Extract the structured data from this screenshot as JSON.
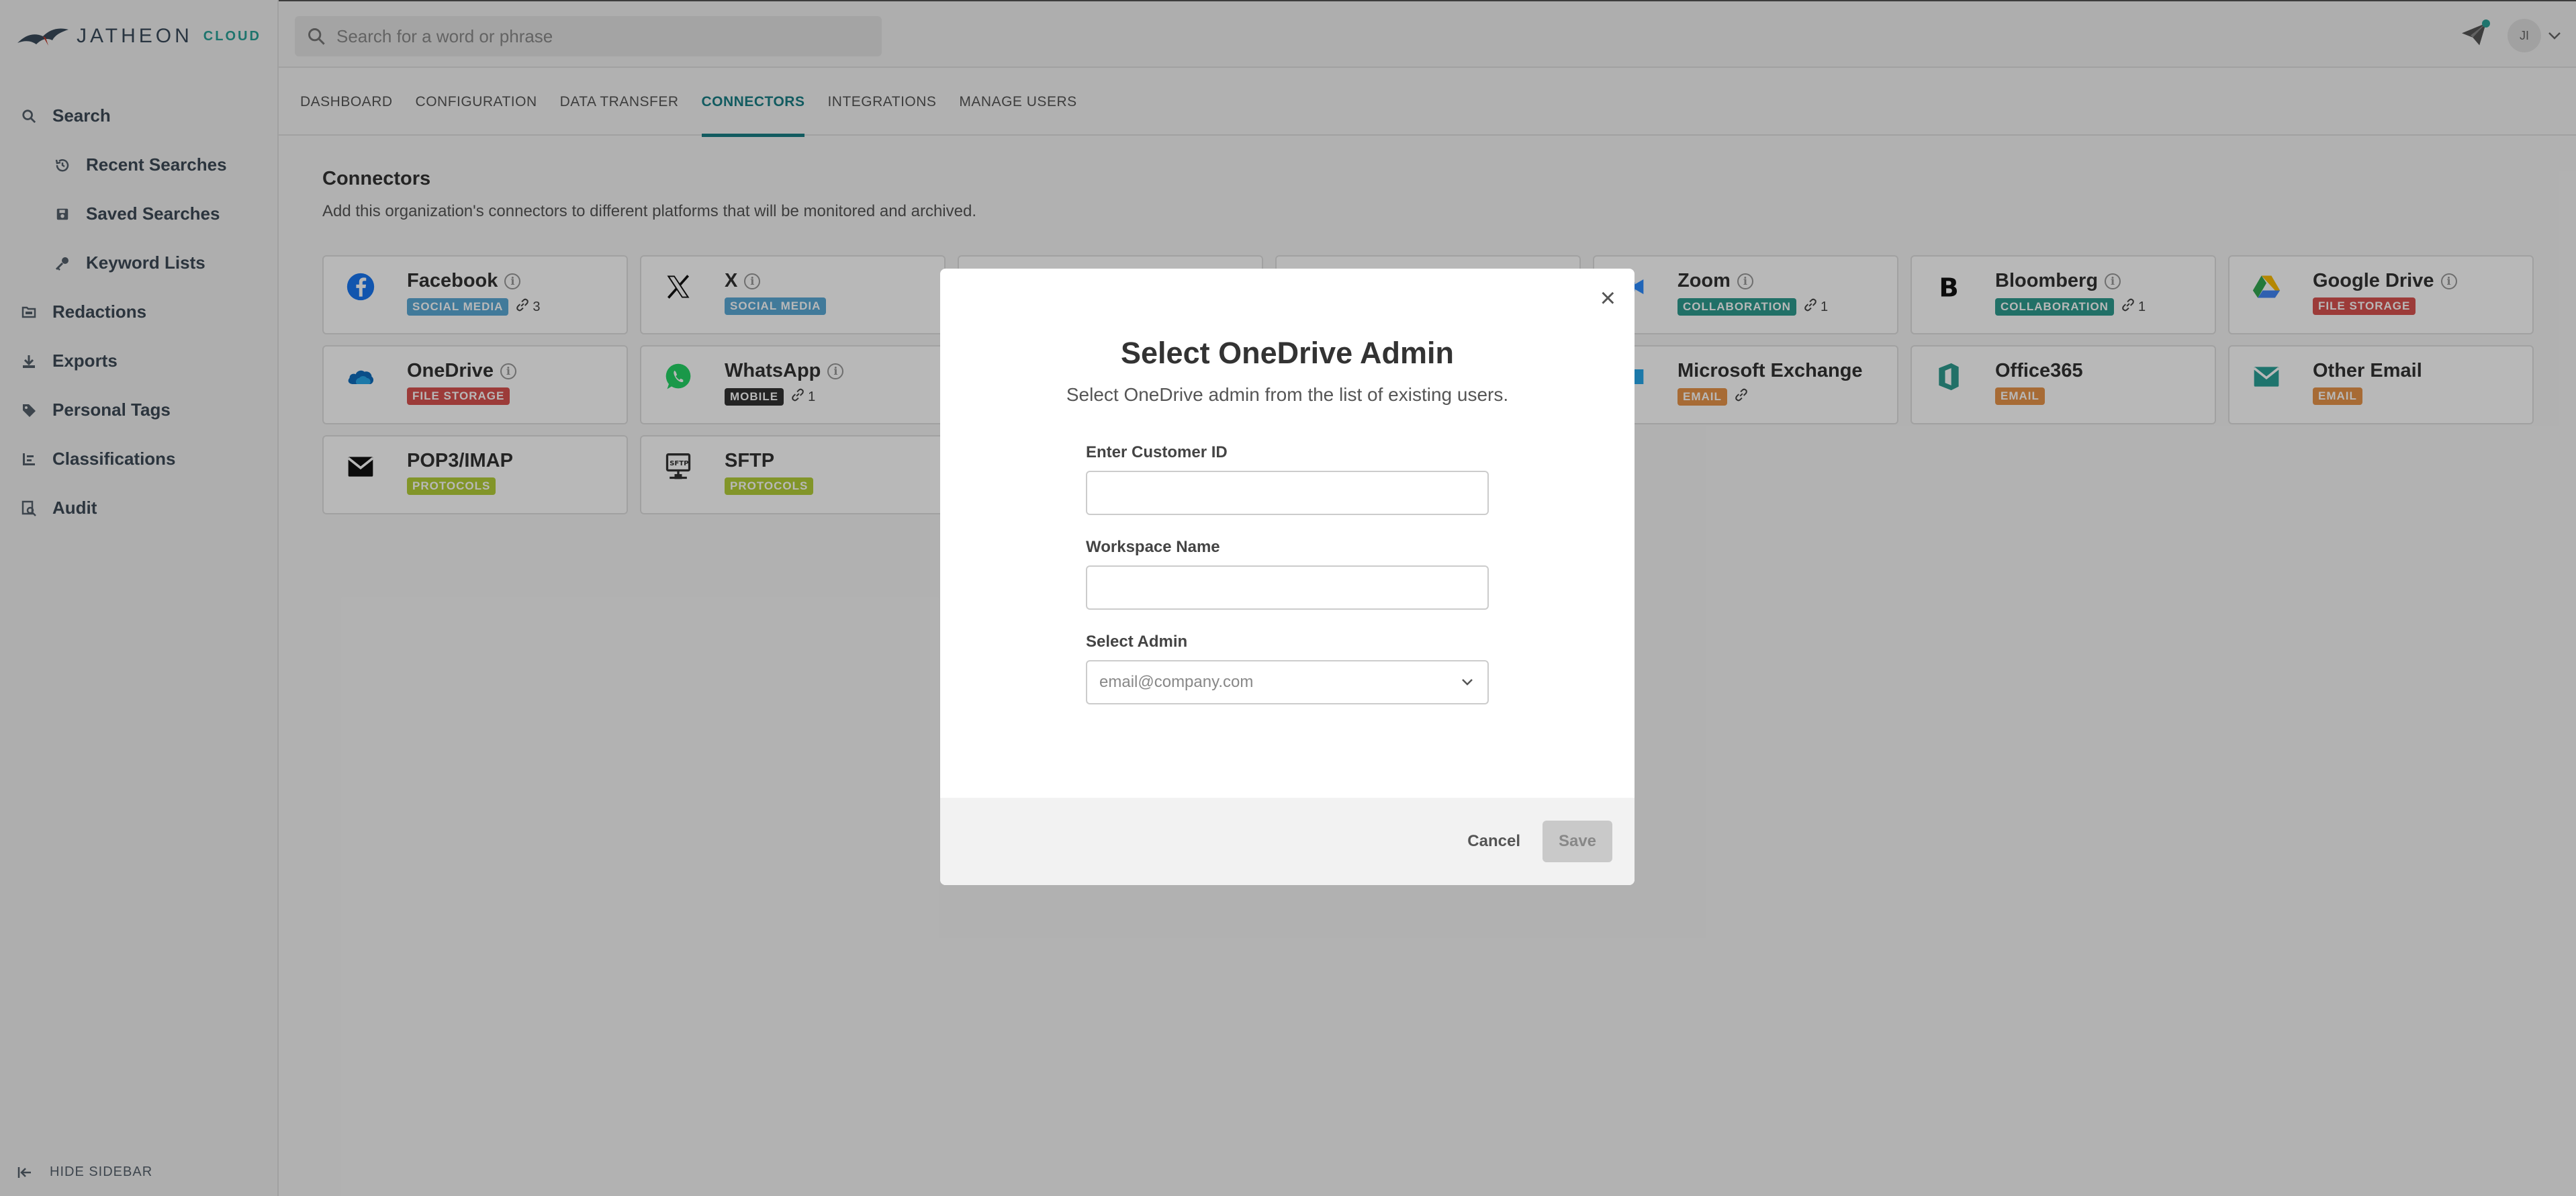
{
  "brand": {
    "name": "JATHEON",
    "suffix": "CLOUD"
  },
  "search": {
    "placeholder": "Search for a word or phrase"
  },
  "user": {
    "initials": "JI"
  },
  "sidebar": {
    "items": [
      {
        "label": "Search",
        "icon": "search-icon"
      },
      {
        "label": "Recent Searches",
        "icon": "history-icon"
      },
      {
        "label": "Saved Searches",
        "icon": "save-icon"
      },
      {
        "label": "Keyword Lists",
        "icon": "key-icon"
      },
      {
        "label": "Redactions",
        "icon": "redaction-icon"
      },
      {
        "label": "Exports",
        "icon": "download-icon"
      },
      {
        "label": "Personal Tags",
        "icon": "tag-icon"
      },
      {
        "label": "Classifications",
        "icon": "classification-icon"
      },
      {
        "label": "Audit",
        "icon": "audit-icon"
      }
    ],
    "hide_label": "HIDE SIDEBAR"
  },
  "tabs": [
    {
      "label": "DASHBOARD"
    },
    {
      "label": "CONFIGURATION"
    },
    {
      "label": "DATA TRANSFER"
    },
    {
      "label": "CONNECTORS",
      "active": true
    },
    {
      "label": "INTEGRATIONS"
    },
    {
      "label": "MANAGE USERS"
    }
  ],
  "page": {
    "title": "Connectors",
    "description": "Add this organization's connectors to different platforms that will be monitored and archived."
  },
  "connectors": [
    {
      "name": "Facebook",
      "badge": "SOCIAL MEDIA",
      "badge_color": "#5aa9d6",
      "count": "3",
      "icon": "facebook-icon"
    },
    {
      "name": "X",
      "badge": "SOCIAL MEDIA",
      "badge_color": "#5aa9d6",
      "count": "",
      "icon": "x-icon"
    },
    {
      "name": "",
      "badge": "",
      "count": "",
      "icon": ""
    },
    {
      "name": "",
      "badge": "",
      "count": "",
      "icon": ""
    },
    {
      "name": "Zoom",
      "badge": "COLLABORATION",
      "badge_color": "#2f9c8f",
      "count": "1",
      "icon": "zoom-icon"
    },
    {
      "name": "Bloomberg",
      "badge": "COLLABORATION",
      "badge_color": "#2f9c8f",
      "count": "1",
      "icon": "bloomberg-icon"
    },
    {
      "name": "Google Drive",
      "badge": "FILE STORAGE",
      "badge_color": "#d9534f",
      "count": "",
      "icon": "google-drive-icon"
    },
    {
      "name": "OneDrive",
      "badge": "FILE STORAGE",
      "badge_color": "#d9534f",
      "count": "",
      "icon": "onedrive-icon"
    },
    {
      "name": "WhatsApp",
      "badge": "MOBILE",
      "badge_color": "#333333",
      "count": "1",
      "icon": "whatsapp-icon"
    },
    {
      "name": "",
      "badge": "",
      "count": "",
      "icon": ""
    },
    {
      "name": "",
      "badge": "",
      "count": "",
      "icon": ""
    },
    {
      "name": "Microsoft Exchange",
      "badge": "EMAIL",
      "badge_color": "#e8954a",
      "count": "",
      "icon": "exchange-icon"
    },
    {
      "name": "Office365",
      "badge": "EMAIL",
      "badge_color": "#e8954a",
      "count": "",
      "icon": "office365-icon"
    },
    {
      "name": "Other Email",
      "badge": "EMAIL",
      "badge_color": "#e8954a",
      "count": "",
      "icon": "email-icon"
    },
    {
      "name": "POP3/IMAP",
      "badge": "PROTOCOLS",
      "badge_color": "#b5cf3a",
      "count": "",
      "icon": "mail-icon"
    },
    {
      "name": "SFTP",
      "badge": "PROTOCOLS",
      "badge_color": "#b5cf3a",
      "count": "",
      "icon": "sftp-icon"
    }
  ],
  "modal": {
    "title": "Select OneDrive Admin",
    "subtitle": "Select OneDrive admin from the list of existing users.",
    "customer_id_label": "Enter Customer ID",
    "customer_id_value": "",
    "workspace_label": "Workspace Name",
    "workspace_value": "",
    "admin_label": "Select Admin",
    "admin_placeholder": "email@company.com",
    "cancel_label": "Cancel",
    "save_label": "Save"
  },
  "colors": {
    "accent": "#1a7f85"
  }
}
